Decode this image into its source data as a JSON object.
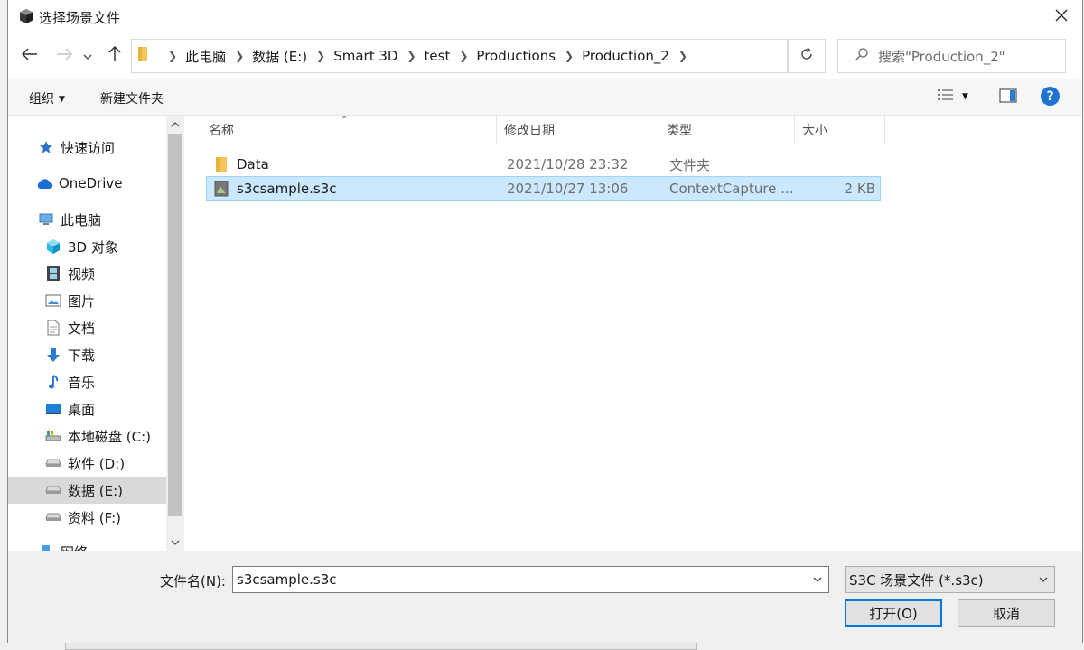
{
  "window": {
    "title": "选择场景文件"
  },
  "breadcrumb": [
    "此电脑",
    "数据 (E:)",
    "Smart 3D",
    "test",
    "Productions",
    "Production_2"
  ],
  "search": {
    "placeholder": "搜索\"Production_2\""
  },
  "toolbar": {
    "organize_label": "组织",
    "new_folder_label": "新建文件夹"
  },
  "nav": {
    "items": [
      {
        "label": "快速访问",
        "icon": "star-icon"
      },
      {
        "label": "OneDrive",
        "icon": "cloud-icon"
      },
      {
        "label": "此电脑",
        "icon": "computer-icon"
      },
      {
        "label": "3D 对象",
        "icon": "cube-icon"
      },
      {
        "label": "视频",
        "icon": "film-icon"
      },
      {
        "label": "图片",
        "icon": "picture-icon"
      },
      {
        "label": "文档",
        "icon": "document-icon"
      },
      {
        "label": "下载",
        "icon": "download-icon"
      },
      {
        "label": "音乐",
        "icon": "music-icon"
      },
      {
        "label": "桌面",
        "icon": "desktop-icon"
      },
      {
        "label": "本地磁盘 (C:)",
        "icon": "drive-icon"
      },
      {
        "label": "软件 (D:)",
        "icon": "drive-icon"
      },
      {
        "label": "数据 (E:)",
        "icon": "drive-icon"
      },
      {
        "label": "资料 (F:)",
        "icon": "drive-icon"
      },
      {
        "label": "网络",
        "icon": "network-icon"
      }
    ],
    "selected_index": 12
  },
  "files": {
    "columns": [
      "名称",
      "修改日期",
      "类型",
      "大小"
    ],
    "rows": [
      {
        "name": "Data",
        "date": "2021/10/28 23:32",
        "type": "文件夹",
        "size": "",
        "icon": "folder-icon"
      },
      {
        "name": "s3csample.s3c",
        "date": "2021/10/27 13:06",
        "type": "ContextCapture ...",
        "size": "2 KB",
        "icon": "s3c-file-icon"
      }
    ]
  },
  "footer": {
    "filename_label": "文件名(N):",
    "filename_value": "s3csample.s3c",
    "filetype_value": "S3C 场景文件 (*.s3c)",
    "open_label": "打开(O)",
    "cancel_label": "取消"
  },
  "colors": {
    "accent": "#0078d7",
    "selection": "#cce8ff",
    "help": "#1e73d3"
  }
}
